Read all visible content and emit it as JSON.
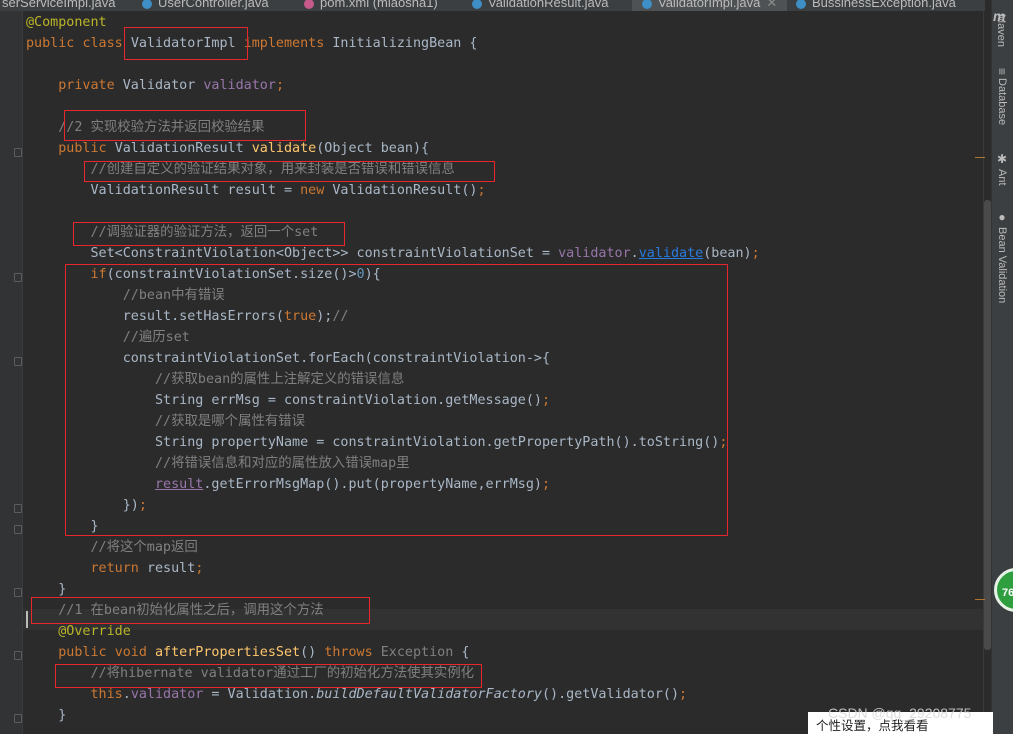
{
  "tabs": [
    {
      "label": "serServiceImpl.java",
      "active": false
    },
    {
      "label": "UserController.java",
      "active": false
    },
    {
      "label": "pom.xml (miaosha1)",
      "active": false
    },
    {
      "label": "ValidationResult.java",
      "active": false
    },
    {
      "label": "ValidatorImpl.java",
      "active": true
    },
    {
      "label": "BussinessException.java",
      "active": false
    }
  ],
  "right_tools": {
    "maven": "Maven",
    "database": "Database",
    "ant": "Ant",
    "bean_validation": "Bean Validation"
  },
  "code": {
    "l1_annotation": "@Component",
    "l2_public": "public",
    "l2_class": "class",
    "l2_classname": "ValidatorImpl",
    "l2_implements": "implements",
    "l2_rest": "InitializingBean {",
    "l3_private": "private",
    "l3_type": "Validator",
    "l3_field": "validator",
    "l3_semi": ";",
    "l4_comment": "//2 实现校验方法并返回校验结果",
    "l5_public": "public",
    "l5_type": "ValidationResult",
    "l5_method": "validate",
    "l5_params": "(Object bean){",
    "l6_comment": "//创建自定义的验证结果对象，用来封装是否错误和错误信息",
    "l7_decl": "ValidationResult result = ",
    "l7_new": "new",
    "l7_call": "ValidationResult()",
    "l7_semi": ";",
    "l8_comment": "//调验证器的验证方法，返回一个set",
    "l9_decl": "Set<ConstraintViolation<Object>> constraintViolationSet = ",
    "l9_field": "validator",
    "l9_dot": ".",
    "l9_method": "validate",
    "l9_args": "(bean)",
    "l9_semi": ";",
    "l10_if": "if",
    "l10_cond": "(constraintViolationSet.size()>",
    "l10_num": "0",
    "l10_end": "){",
    "l11_comment": "//bean中有错误",
    "l12_call": "result.setHasErrors(",
    "l12_true": "true",
    "l12_end": ");",
    "l12_comment": "//",
    "l13_comment": "//遍历set",
    "l14_code": "constraintViolationSet.forEach(constraintViolation->{",
    "l15_comment": "//获取bean的属性上注解定义的错误信息",
    "l16_code": "String errMsg = constraintViolation.getMessage()",
    "l16_semi": ";",
    "l17_comment": "//获取是哪个属性有错误",
    "l18_code": "String propertyName = constraintViolation.getPropertyPath().toString()",
    "l18_semi": ";",
    "l19_comment": "//将错误信息和对应的属性放入错误map里",
    "l20_var": "result",
    "l20_code": ".getErrorMsgMap().put(propertyName,errMsg)",
    "l20_semi": ";",
    "l21_code": "})",
    "l21_semi": ";",
    "l22_brace": "}",
    "l23_comment": "//将这个map返回",
    "l24_return": "return",
    "l24_var": "result",
    "l24_semi": ";",
    "l25_brace": "}",
    "l26_comment": "//1 在bean初始化属性之后，调用这个方法",
    "l27_annotation": "@Override",
    "l28_public": "public",
    "l28_void": "void",
    "l28_method": "afterPropertiesSet",
    "l28_parens": "()",
    "l28_throws": "throws",
    "l28_exc": "Exception",
    "l28_brace": "{",
    "l29_comment": "//将hibernate validator通过工厂的初始化方法使其实例化",
    "l30_this": "this",
    "l30_dot": ".",
    "l30_field": "validator",
    "l30_eq": " = Validation.",
    "l30_static": "buildDefaultValidatorFactory",
    "l30_rest": "().getValidator()",
    "l30_semi": ";",
    "l31_brace": "}"
  },
  "badge": {
    "value": "76"
  },
  "watermark": "CSDN @qq_29208775",
  "toast": "个性设置，点我看看"
}
